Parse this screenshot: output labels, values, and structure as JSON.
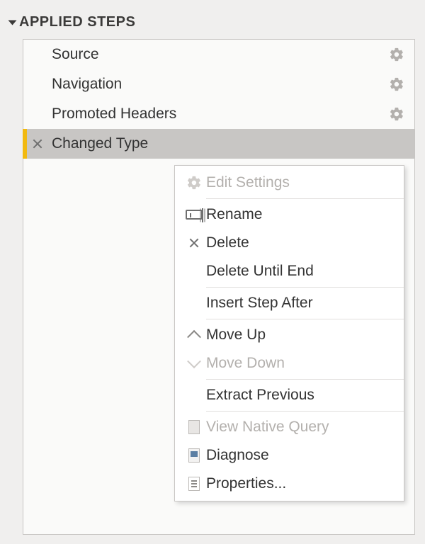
{
  "panel": {
    "title": "APPLIED STEPS"
  },
  "steps": [
    {
      "label": "Source",
      "has_gear": true,
      "selected": false,
      "has_x": false
    },
    {
      "label": "Navigation",
      "has_gear": true,
      "selected": false,
      "has_x": false
    },
    {
      "label": "Promoted Headers",
      "has_gear": true,
      "selected": false,
      "has_x": false
    },
    {
      "label": "Changed Type",
      "has_gear": false,
      "selected": true,
      "has_x": true
    }
  ],
  "menu": [
    {
      "label": "Edit Settings",
      "icon": "gear",
      "disabled": true,
      "sep": false
    },
    {
      "label": "Rename",
      "icon": "rename",
      "disabled": false,
      "sep": true
    },
    {
      "label": "Delete",
      "icon": "x",
      "disabled": false,
      "sep": false
    },
    {
      "label": "Delete Until End",
      "icon": "",
      "disabled": false,
      "sep": false
    },
    {
      "label": "Insert Step After",
      "icon": "",
      "disabled": false,
      "sep": true
    },
    {
      "label": "Move Up",
      "icon": "chev-up",
      "disabled": false,
      "sep": true
    },
    {
      "label": "Move Down",
      "icon": "chev-down",
      "disabled": true,
      "sep": false
    },
    {
      "label": "Extract Previous",
      "icon": "",
      "disabled": false,
      "sep": true
    },
    {
      "label": "View Native Query",
      "icon": "doc-stack",
      "disabled": true,
      "sep": true
    },
    {
      "label": "Diagnose",
      "icon": "doc-diag",
      "disabled": false,
      "sep": false
    },
    {
      "label": "Properties...",
      "icon": "doc-prop",
      "disabled": false,
      "sep": false
    }
  ]
}
